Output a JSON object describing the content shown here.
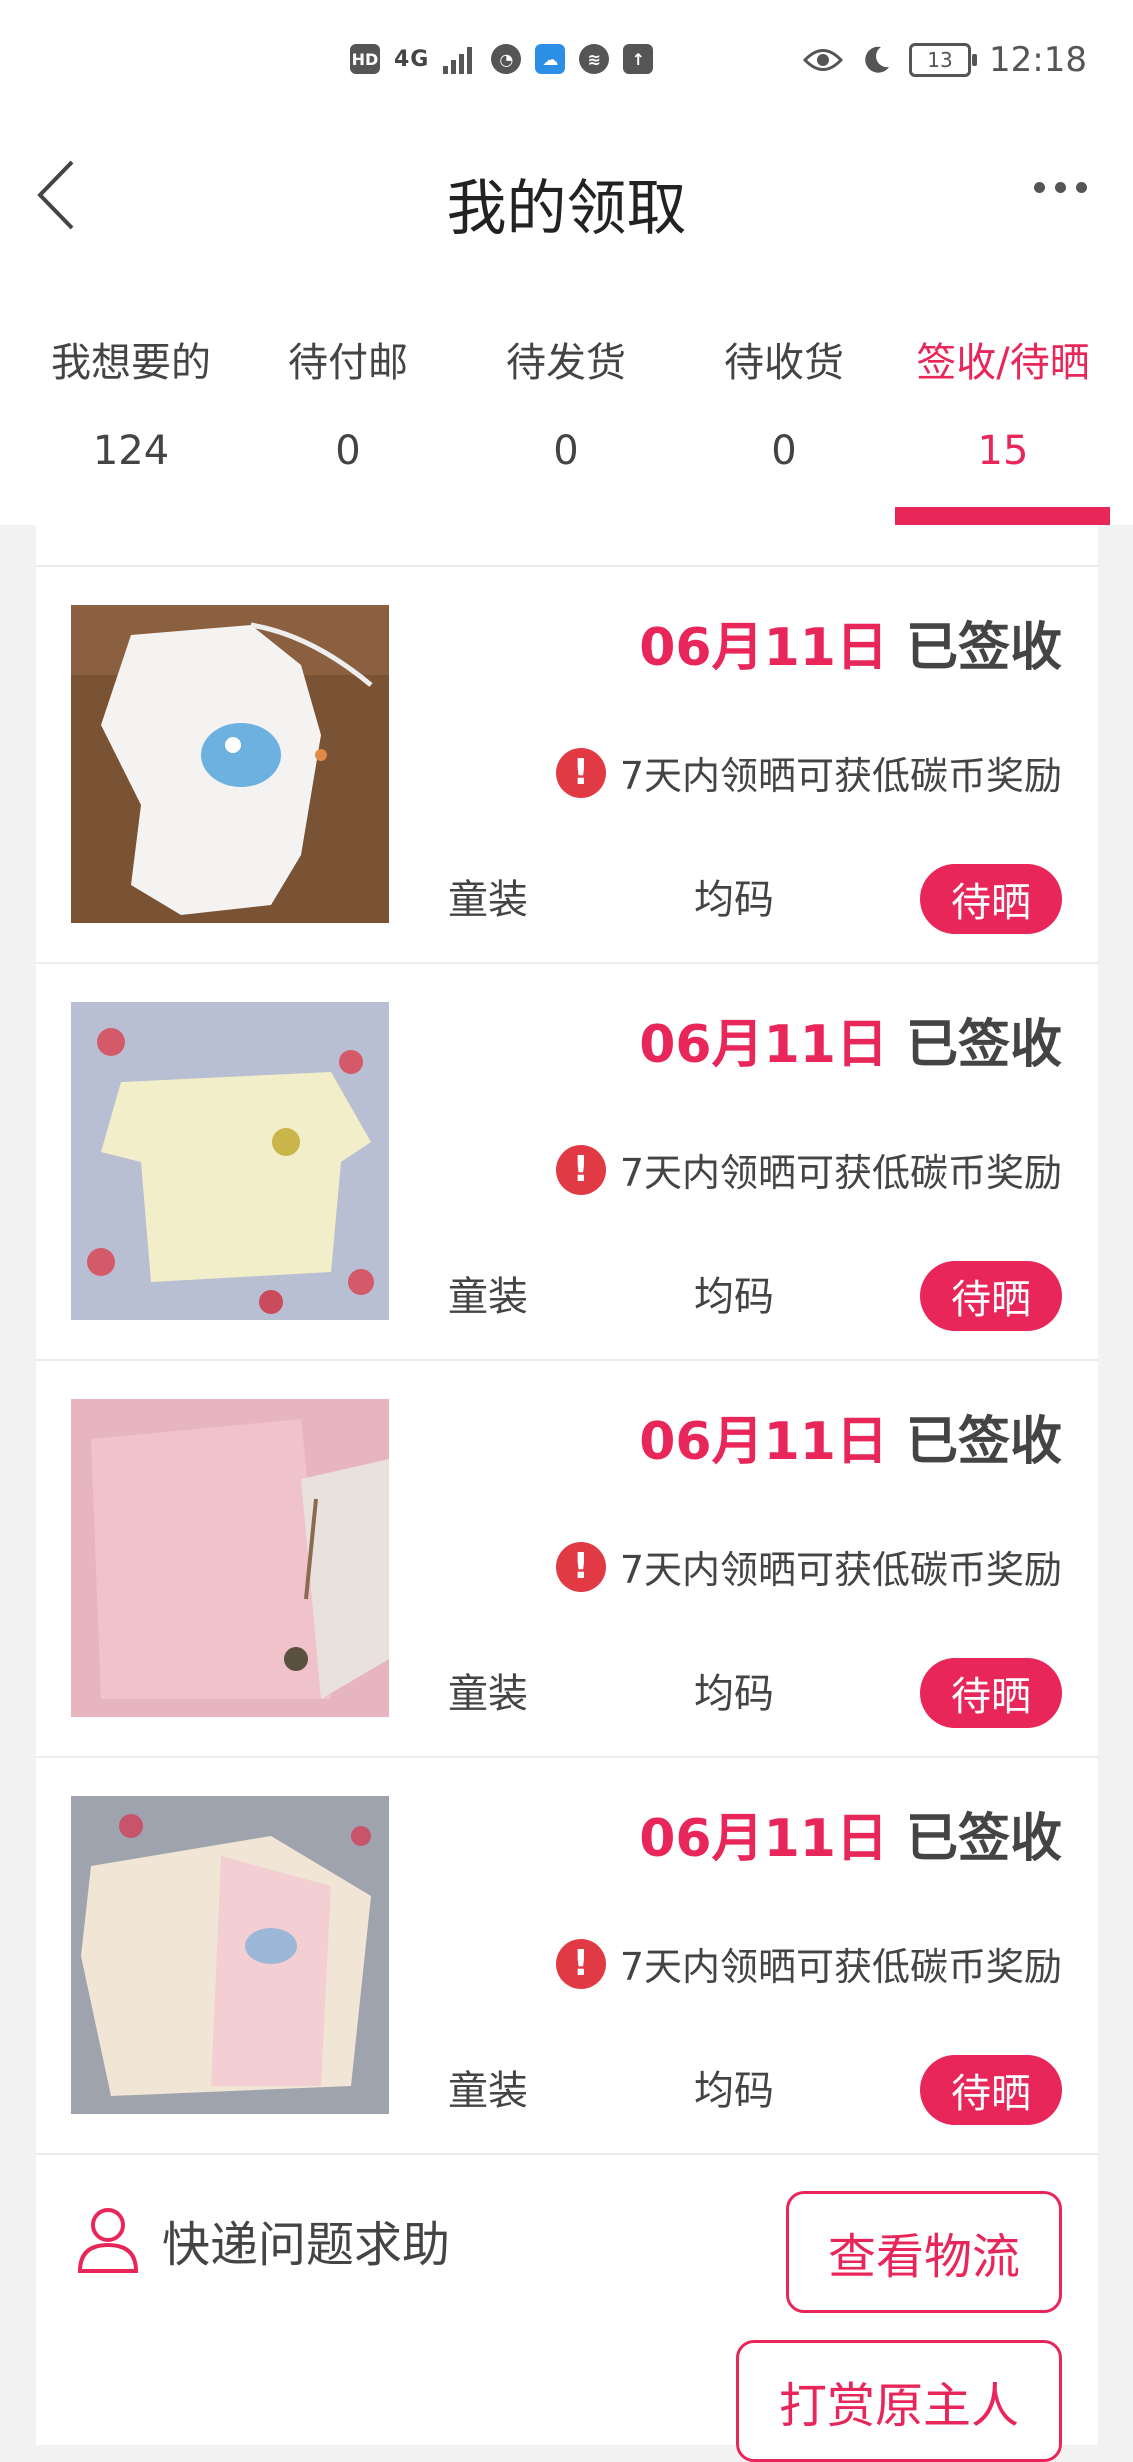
{
  "status_bar": {
    "left_icons": [
      "HD",
      "4G",
      "signal-bars",
      "timer-icon",
      "weather-app-icon",
      "voice-icon",
      "upload-icon"
    ],
    "eye_icon": "eye-icon",
    "moon_icon": "moon-icon",
    "battery": "13",
    "time": "12:18"
  },
  "header": {
    "title": "我的领取"
  },
  "tabs": [
    {
      "label": "我想要的",
      "count": "124"
    },
    {
      "label": "待付邮",
      "count": "0"
    },
    {
      "label": "待发货",
      "count": "0"
    },
    {
      "label": "待收货",
      "count": "0"
    },
    {
      "label": "签收/待晒",
      "count": "15",
      "active": true
    }
  ],
  "items": [
    {
      "date": "06月11日",
      "status": "已签收",
      "notice": "7天内领晒可获低碳币奖励",
      "category": "童装",
      "size": "均码",
      "action": "待晒",
      "image": "white-baby-romper"
    },
    {
      "date": "06月11日",
      "status": "已签收",
      "notice": "7天内领晒可获低碳币奖励",
      "category": "童装",
      "size": "均码",
      "action": "待晒",
      "image": "cream-striped-shirt"
    },
    {
      "date": "06月11日",
      "status": "已签收",
      "notice": "7天内领晒可获低碳币奖励",
      "category": "童装",
      "size": "均码",
      "action": "待晒",
      "image": "pink-baby-top"
    },
    {
      "date": "06月11日",
      "status": "已签收",
      "notice": "7天内领晒可获低碳币奖励",
      "category": "童装",
      "size": "均码",
      "action": "待晒",
      "image": "striped-baby-cardigan"
    }
  ],
  "footer": {
    "help_label": "快递问题求助",
    "view_logistics": "查看物流",
    "tip_owner": "打赏原主人"
  },
  "colors": {
    "accent": "#e8265a",
    "alert": "#e23a44"
  }
}
